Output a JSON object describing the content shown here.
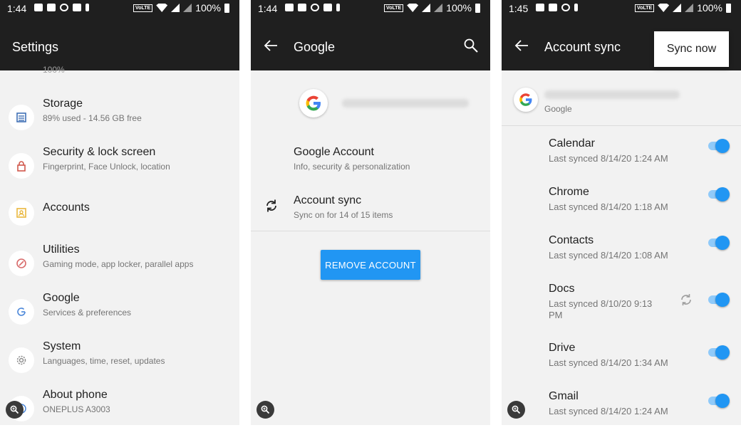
{
  "status": {
    "time_1": "1:44",
    "time_2": "1:44",
    "time_3": "1:45",
    "volte": "VoLTE",
    "battery": "100%"
  },
  "screen1": {
    "title": "Settings",
    "cut_text": "100%",
    "items": [
      {
        "title": "Storage",
        "subtitle": "89% used - 14.56 GB free",
        "icon": "storage-icon",
        "icon_color": "#3f6fb5"
      },
      {
        "title": "Security & lock screen",
        "subtitle": "Fingerprint, Face Unlock, location",
        "icon": "lock-icon",
        "icon_color": "#d0574b"
      },
      {
        "title": "Accounts",
        "subtitle": "",
        "icon": "account-box-icon",
        "icon_color": "#e9b73d"
      },
      {
        "title": "Utilities",
        "subtitle": "Gaming mode, app locker, parallel apps",
        "icon": "utilities-icon",
        "icon_color": "#d86b6b"
      },
      {
        "title": "Google",
        "subtitle": "Services & preferences",
        "icon": "google-g-icon",
        "icon_color": "#4a86d9"
      },
      {
        "title": "System",
        "subtitle": "Languages, time, reset, updates",
        "icon": "gear-icon",
        "icon_color": "#8d8d8d"
      },
      {
        "title": "About phone",
        "subtitle": "ONEPLUS A3003",
        "icon": "info-icon",
        "icon_color": "#4a86d9"
      }
    ]
  },
  "screen2": {
    "title": "Google",
    "google_account": {
      "title": "Google Account",
      "subtitle": "Info, security & personalization"
    },
    "account_sync": {
      "title": "Account sync",
      "subtitle": "Sync on for 14 of 15 items"
    },
    "remove_button": "REMOVE ACCOUNT"
  },
  "screen3": {
    "title": "Account sync",
    "menu_item": "Sync now",
    "account_provider": "Google",
    "items": [
      {
        "title": "Calendar",
        "subtitle": "Last synced 8/14/20 1:24 AM",
        "enabled": true,
        "syncing": false
      },
      {
        "title": "Chrome",
        "subtitle": "Last synced 8/14/20 1:18 AM",
        "enabled": true,
        "syncing": false
      },
      {
        "title": "Contacts",
        "subtitle": "Last synced 8/14/20 1:08 AM",
        "enabled": true,
        "syncing": false
      },
      {
        "title": "Docs",
        "subtitle": "Last synced 8/10/20 9:13 PM",
        "enabled": true,
        "syncing": true
      },
      {
        "title": "Drive",
        "subtitle": "Last synced 8/14/20 1:34 AM",
        "enabled": true,
        "syncing": false
      },
      {
        "title": "Gmail",
        "subtitle": "Last synced 8/14/20 1:24 AM",
        "enabled": true,
        "syncing": false
      }
    ]
  },
  "colors": {
    "appbar": "#1f1f1f",
    "accent": "#2196f3",
    "background": "#f2f2f2"
  }
}
